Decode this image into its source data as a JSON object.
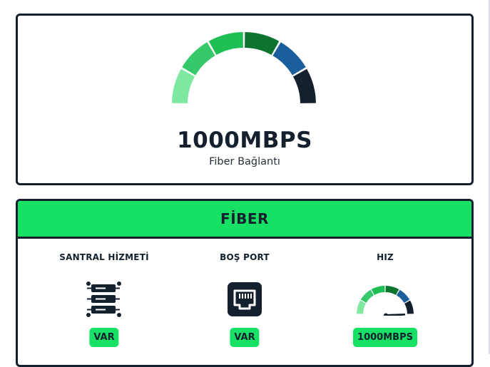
{
  "speed_card": {
    "speed_value": "1000MBPS",
    "connection_label": "Fiber Bağlantı",
    "gauge_segment_colors": [
      "#7ee8a0",
      "#35c96a",
      "#1fbf55",
      "#0d7430",
      "#1a5e9c",
      "#14202e"
    ]
  },
  "plan": {
    "title": "FİBER",
    "features": [
      {
        "label": "SANTRAL HİZMETİ",
        "icon": "server-rack-icon",
        "value": "VAR"
      },
      {
        "label": "BOŞ PORT",
        "icon": "ethernet-port-icon",
        "value": "VAR"
      },
      {
        "label": "HIZ",
        "icon": "speedometer-icon",
        "value": "1000MBPS"
      }
    ]
  },
  "colors": {
    "accent_green": "#16e165",
    "dark": "#14202e"
  }
}
